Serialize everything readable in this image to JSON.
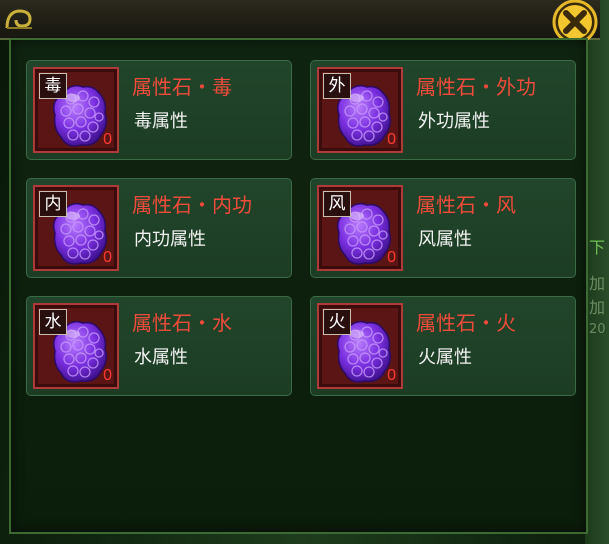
{
  "right_fragments": [
    "下",
    "加",
    "加",
    "20"
  ],
  "colors": {
    "name_red": "#ef4a3a",
    "gem_purple": "#7a2fe0",
    "frame_red": "#b03a3a",
    "card_green": "#21452a"
  },
  "items": [
    {
      "badge": "毒",
      "name": "属性石・毒",
      "desc": "毒属性",
      "qty": "0"
    },
    {
      "badge": "外",
      "name": "属性石・外功",
      "desc": "外功属性",
      "qty": "0"
    },
    {
      "badge": "内",
      "name": "属性石・内功",
      "desc": "内功属性",
      "qty": "0"
    },
    {
      "badge": "风",
      "name": "属性石・风",
      "desc": "风属性",
      "qty": "0"
    },
    {
      "badge": "水",
      "name": "属性石・水",
      "desc": "水属性",
      "qty": "0"
    },
    {
      "badge": "火",
      "name": "属性石・火",
      "desc": "火属性",
      "qty": "0"
    }
  ],
  "icons": {
    "close": "close-x-icon",
    "gem": "purple-gem-icon",
    "ornament": "gold-scroll-ornament-icon"
  }
}
